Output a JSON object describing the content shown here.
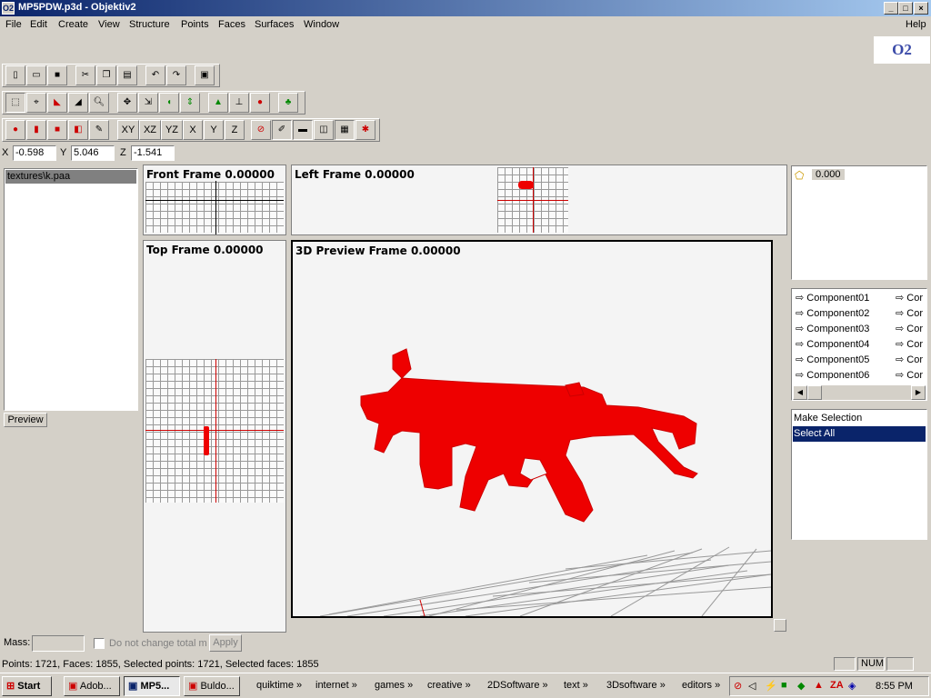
{
  "window": {
    "title": "MP5PDW.p3d - Objektiv2",
    "min": "_",
    "max": "□",
    "close": "×"
  },
  "menu": [
    "File",
    "Edit",
    "Create",
    "View",
    "Structure",
    "Points",
    "Faces",
    "Surfaces",
    "Window"
  ],
  "menu_help": "Help",
  "logo": "O2",
  "axis_buttons": [
    "XY",
    "XZ",
    "YZ",
    "X",
    "Y",
    "Z"
  ],
  "coords": {
    "x_label": "X",
    "x": "-0.598",
    "y_label": "Y",
    "y": "5.046",
    "z_label": "Z",
    "z": "-1.541"
  },
  "textures": {
    "item": "textures\\k.paa",
    "preview": "Preview"
  },
  "frames": {
    "front": "Front Frame 0.00000",
    "left": "Left Frame 0.00000",
    "top": "Top Frame 0.00000",
    "preview": "3D Preview Frame 0.00000"
  },
  "lod": {
    "value": "0.000"
  },
  "components": [
    "Component01",
    "Component02",
    "Component03",
    "Component04",
    "Component05",
    "Component06"
  ],
  "components_col2": [
    "Cor",
    "Cor",
    "Cor",
    "Cor",
    "Cor",
    "Cor"
  ],
  "selections": [
    "Make Selection",
    "Select All"
  ],
  "mass": {
    "label": "Mass:",
    "checkbox_label": "Do not change total ma",
    "apply": "Apply"
  },
  "status": {
    "text": "Points: 1721, Faces: 1855, Selected points: 1721, Selected faces: 1855",
    "num": "NUM"
  },
  "taskbar": {
    "start": "Start",
    "tasks": [
      "Adob...",
      "MP5...",
      "Buldo..."
    ],
    "quicklinks": [
      "quiktime",
      "internet",
      "games",
      "creative",
      "2DSoftware",
      "text",
      "3Dsoftware",
      "editors"
    ],
    "clock": "8:55 PM"
  },
  "colors": {
    "model": "#ee0000",
    "title": "#0a246a",
    "selected": "#0a246a"
  }
}
